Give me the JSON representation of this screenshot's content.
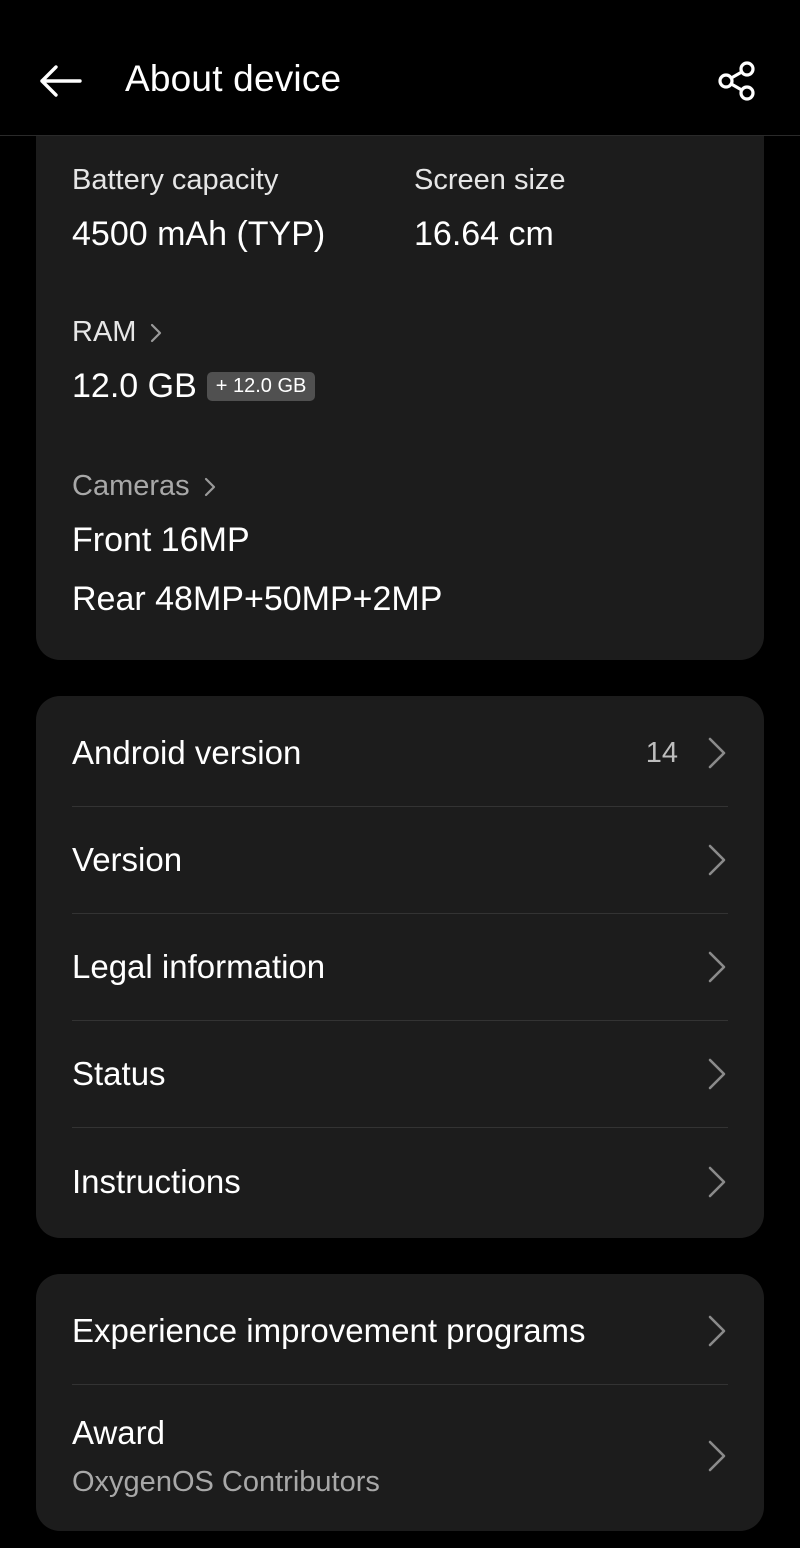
{
  "header": {
    "title": "About device",
    "back_icon": "arrow-left-icon",
    "share_icon": "share-icon"
  },
  "specs": {
    "battery": {
      "label": "Battery capacity",
      "value": "4500 mAh (TYP)"
    },
    "screen": {
      "label": "Screen size",
      "value": "16.64 cm"
    },
    "ram": {
      "label": "RAM",
      "value": "12.0 GB",
      "badge": "+ 12.0 GB"
    },
    "cameras": {
      "label": "Cameras",
      "front": "Front 16MP",
      "rear": "Rear 48MP+50MP+2MP"
    }
  },
  "system": {
    "android": {
      "label": "Android version",
      "value": "14"
    },
    "version": {
      "label": "Version"
    },
    "legal": {
      "label": "Legal information"
    },
    "status": {
      "label": "Status"
    },
    "instructions": {
      "label": "Instructions"
    }
  },
  "more": {
    "experience": {
      "label": "Experience improvement programs"
    },
    "award": {
      "label": "Award",
      "subtitle": "OxygenOS Contributors"
    }
  },
  "colors": {
    "background": "#000000",
    "card": "#1c1c1c",
    "divider": "#333333",
    "badge": "#505050",
    "text_primary": "#ffffff",
    "text_secondary": "#a8a8a8"
  }
}
